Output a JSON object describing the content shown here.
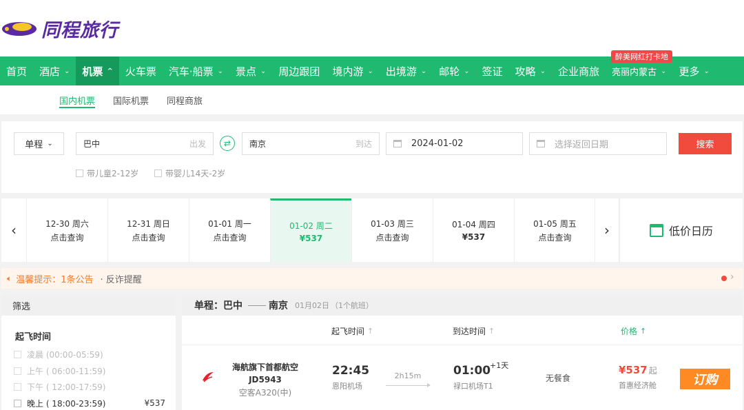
{
  "brand": {
    "name": "同程旅行"
  },
  "nav": {
    "items": [
      {
        "label": "首页",
        "chev": false
      },
      {
        "label": "酒店",
        "chev": true
      },
      {
        "label": "机票",
        "chev": true,
        "active": true
      },
      {
        "label": "火车票",
        "chev": false
      },
      {
        "label": "汽车·船票",
        "chev": true
      },
      {
        "label": "景点",
        "chev": true
      },
      {
        "label": "周边跟团",
        "chev": false
      },
      {
        "label": "境内游",
        "chev": true
      },
      {
        "label": "出境游",
        "chev": true
      },
      {
        "label": "邮轮",
        "chev": true
      },
      {
        "label": "签证",
        "chev": false
      },
      {
        "label": "攻略",
        "chev": true
      },
      {
        "label": "企业商旅",
        "chev": false
      },
      {
        "label": "亮丽内蒙古",
        "chev": true,
        "small": true
      },
      {
        "label": "更多",
        "chev": true
      }
    ],
    "promo_badge": "醉美网红打卡地"
  },
  "subnav": {
    "items": [
      "国内机票",
      "国际机票",
      "同程商旅"
    ]
  },
  "search": {
    "trip_type": "单程",
    "from_value": "巴中",
    "from_hint": "出发",
    "to_value": "南京",
    "to_hint": "到达",
    "depart_date": "2024-01-02",
    "return_placeholder": "选择返回日期",
    "search_label": "搜索",
    "child_label": "带儿童2-12岁",
    "infant_label": "带婴儿14天-2岁"
  },
  "dates": [
    {
      "date": "12-30 周六",
      "price": "点击查询"
    },
    {
      "date": "12-31 周日",
      "price": "点击查询"
    },
    {
      "date": "01-01 周一",
      "price": "点击查询"
    },
    {
      "date": "01-02 周二",
      "price": "¥537",
      "active": true
    },
    {
      "date": "01-03 周三",
      "price": "点击查询"
    },
    {
      "date": "01-04 周四",
      "price": "¥537"
    },
    {
      "date": "01-05 周五",
      "price": "点击查询"
    }
  ],
  "low_price_calendar": "低价日历",
  "notice": {
    "title": "温馨提示：1条公告",
    "extra": "· 反诈提醒"
  },
  "filter": {
    "header": "筛选",
    "section": "起飞时间",
    "options": [
      {
        "label": "凌晨 (00:00-05:59)",
        "enabled": false
      },
      {
        "label": "上午 ( 06:00-11:59)",
        "enabled": false
      },
      {
        "label": "下午 ( 12:00-17:59)",
        "enabled": false
      },
      {
        "label": "晚上 ( 18:00-23:59)",
        "enabled": true,
        "price": "¥537"
      }
    ]
  },
  "results": {
    "trip_label": "单程：巴中",
    "to_city": "南京",
    "date": "01月02日",
    "count": "（1个航班）",
    "columns": {
      "depart": "起飞时间",
      "arrive": "到达时间",
      "price": "价格"
    },
    "flight": {
      "airline": "海航旗下首都航空",
      "code": "JD5943",
      "aircraft": "空客A320(中)",
      "depart_time": "22:45",
      "depart_airport": "恩阳机场",
      "duration": "2h15m",
      "arrive_time": "01:00",
      "arrive_plus": "+1天",
      "arrive_airport": "禄口机场T1",
      "meal": "无餐食",
      "price": "¥537",
      "price_suffix": "起",
      "cabin": "首惠经济舱",
      "book_label": "订购"
    }
  },
  "colors": {
    "brand_green": "#1fb970",
    "accent_red": "#f04b3c",
    "brand_purple": "#5a2aa0",
    "book_orange": "#ff8a24"
  }
}
